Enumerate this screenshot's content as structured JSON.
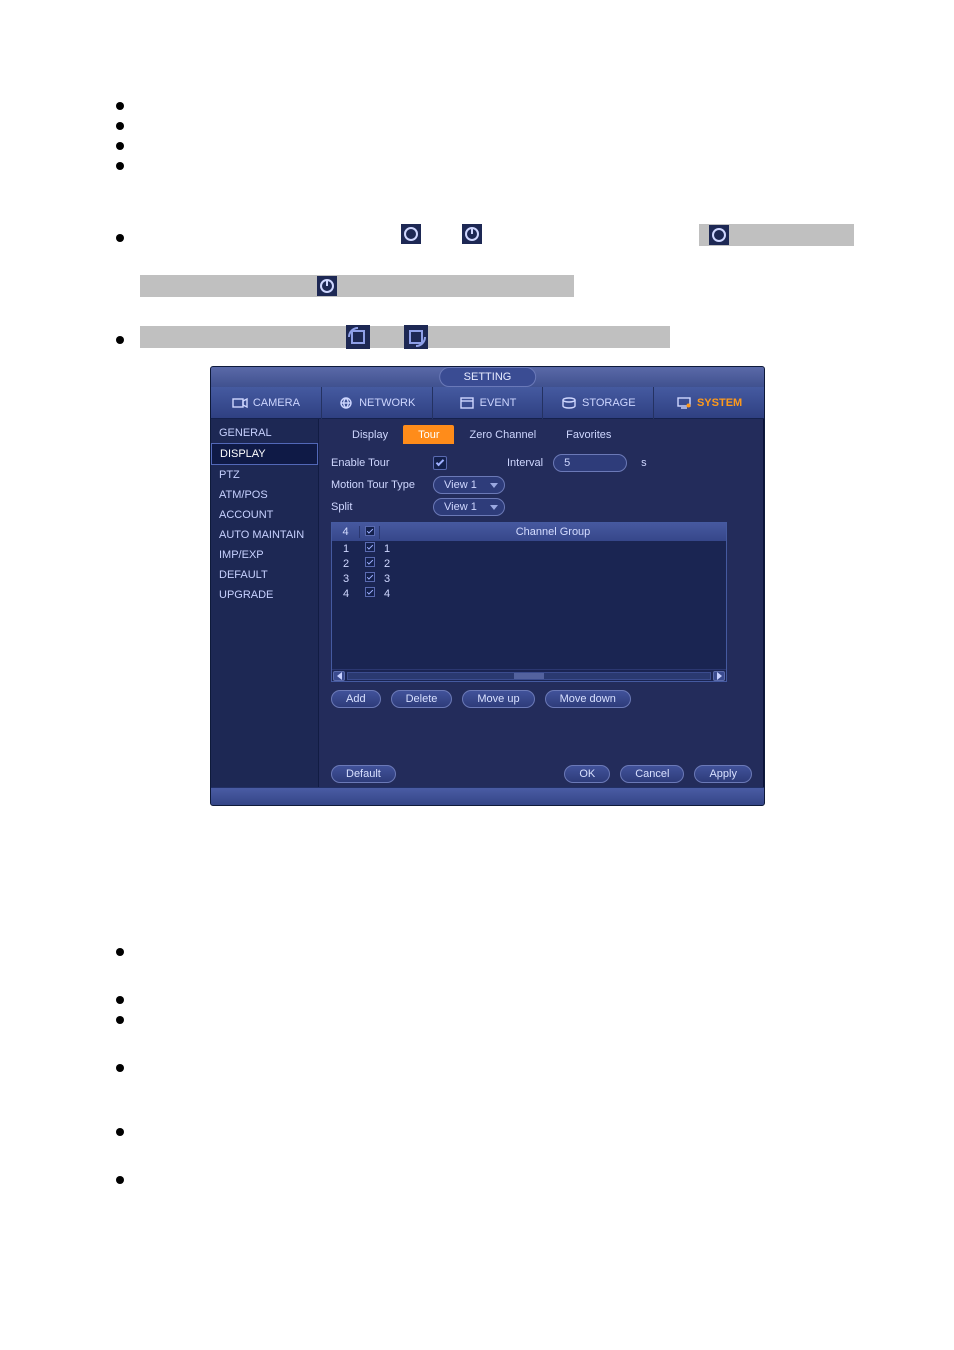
{
  "window_title": "SETTING",
  "nav": {
    "items": [
      {
        "label": "CAMERA",
        "icon": "camera-icon"
      },
      {
        "label": "NETWORK",
        "icon": "network-icon"
      },
      {
        "label": "EVENT",
        "icon": "event-icon"
      },
      {
        "label": "STORAGE",
        "icon": "storage-icon"
      },
      {
        "label": "SYSTEM",
        "icon": "system-icon"
      }
    ],
    "active": 4
  },
  "sidebar": {
    "items": [
      "GENERAL",
      "DISPLAY",
      "PTZ",
      "ATM/POS",
      "ACCOUNT",
      "AUTO MAINTAIN",
      "IMP/EXP",
      "DEFAULT",
      "UPGRADE"
    ],
    "active": 1
  },
  "subtabs": {
    "items": [
      "Display",
      "Tour",
      "Zero Channel",
      "Favorites"
    ],
    "active": 1
  },
  "form": {
    "enable_tour_label": "Enable Tour",
    "enable_tour_checked": true,
    "interval_label": "Interval",
    "interval_value": "5",
    "interval_unit": "s",
    "motion_label": "Motion Tour Type",
    "motion_value": "View 1",
    "split_label": "Split",
    "split_value": "View 1"
  },
  "table": {
    "count_header": "4",
    "group_header": "Channel Group",
    "rows": [
      {
        "idx": "1",
        "checked": true,
        "group": "1"
      },
      {
        "idx": "2",
        "checked": true,
        "group": "2"
      },
      {
        "idx": "3",
        "checked": true,
        "group": "3"
      },
      {
        "idx": "4",
        "checked": true,
        "group": "4"
      }
    ]
  },
  "table_buttons": {
    "add": "Add",
    "delete": "Delete",
    "moveup": "Move up",
    "movedown": "Move down"
  },
  "bottom": {
    "default": "Default",
    "ok": "OK",
    "cancel": "Cancel",
    "apply": "Apply"
  }
}
